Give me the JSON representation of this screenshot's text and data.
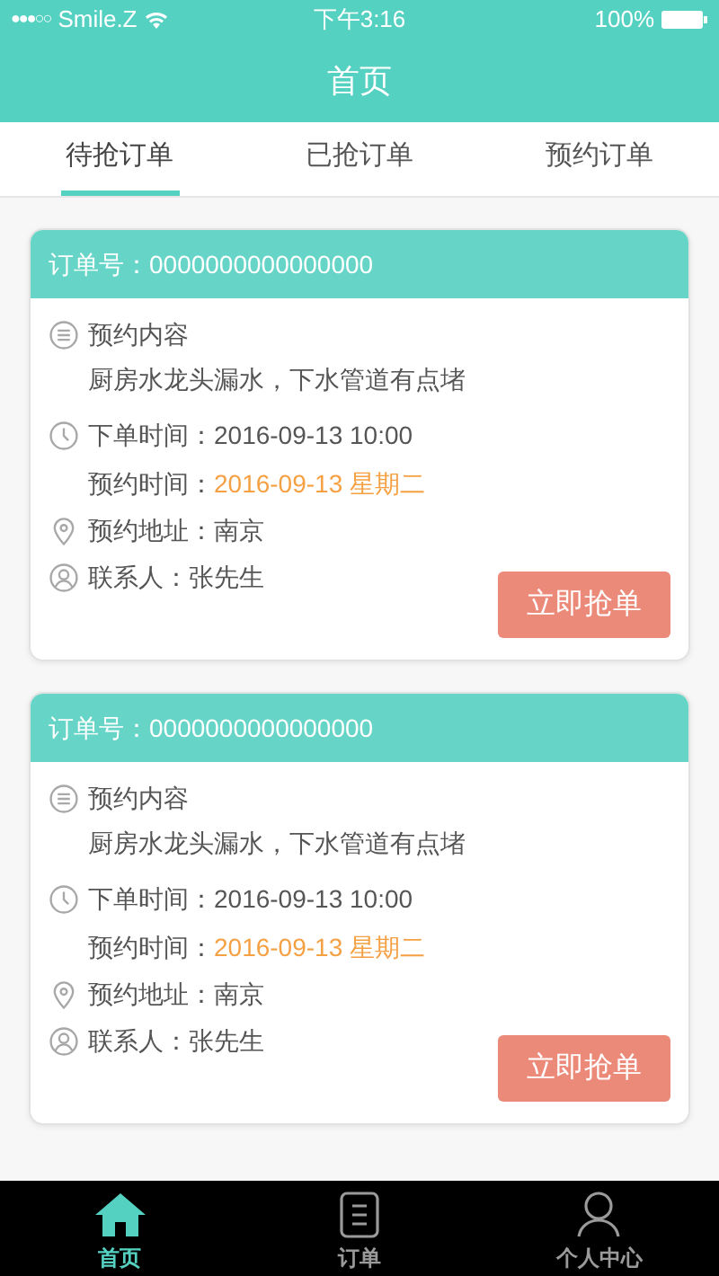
{
  "status_bar": {
    "signal": "●●●○○",
    "carrier": "Smile.Z",
    "time": "下午3:16",
    "battery": "100%"
  },
  "header": {
    "title": "首页"
  },
  "tabs": [
    {
      "label": "待抢订单",
      "selected": true
    },
    {
      "label": "已抢订单",
      "selected": false
    },
    {
      "label": "预约订单",
      "selected": false
    }
  ],
  "orders": [
    {
      "order_no": "订单号：0000000000000000",
      "content_label": "预约内容",
      "content": "厨房水龙头漏水，下水管道有点堵",
      "order_time_label": "下单时间：",
      "order_time": "2016-09-13 10:00",
      "appointment_label": "预约时间：",
      "appointment": "2016-09-13 星期二",
      "address": "预约地址：南京",
      "contact": "联系人：张先生",
      "button": "立即抢单"
    },
    {
      "order_no": "订单号：0000000000000000",
      "content_label": "预约内容",
      "content": "厨房水龙头漏水，下水管道有点堵",
      "order_time_label": "下单时间：",
      "order_time": "2016-09-13 10:00",
      "appointment_label": "预约时间：",
      "appointment": "2016-09-13 星期二",
      "address": "预约地址：南京",
      "contact": "联系人：张先生",
      "button": "立即抢单"
    }
  ],
  "tab_bar": [
    {
      "label": "首页",
      "kind": "home",
      "selected": true
    },
    {
      "label": "订单",
      "kind": "orders",
      "selected": false
    },
    {
      "label": "个人中心",
      "kind": "profile",
      "selected": false
    }
  ]
}
